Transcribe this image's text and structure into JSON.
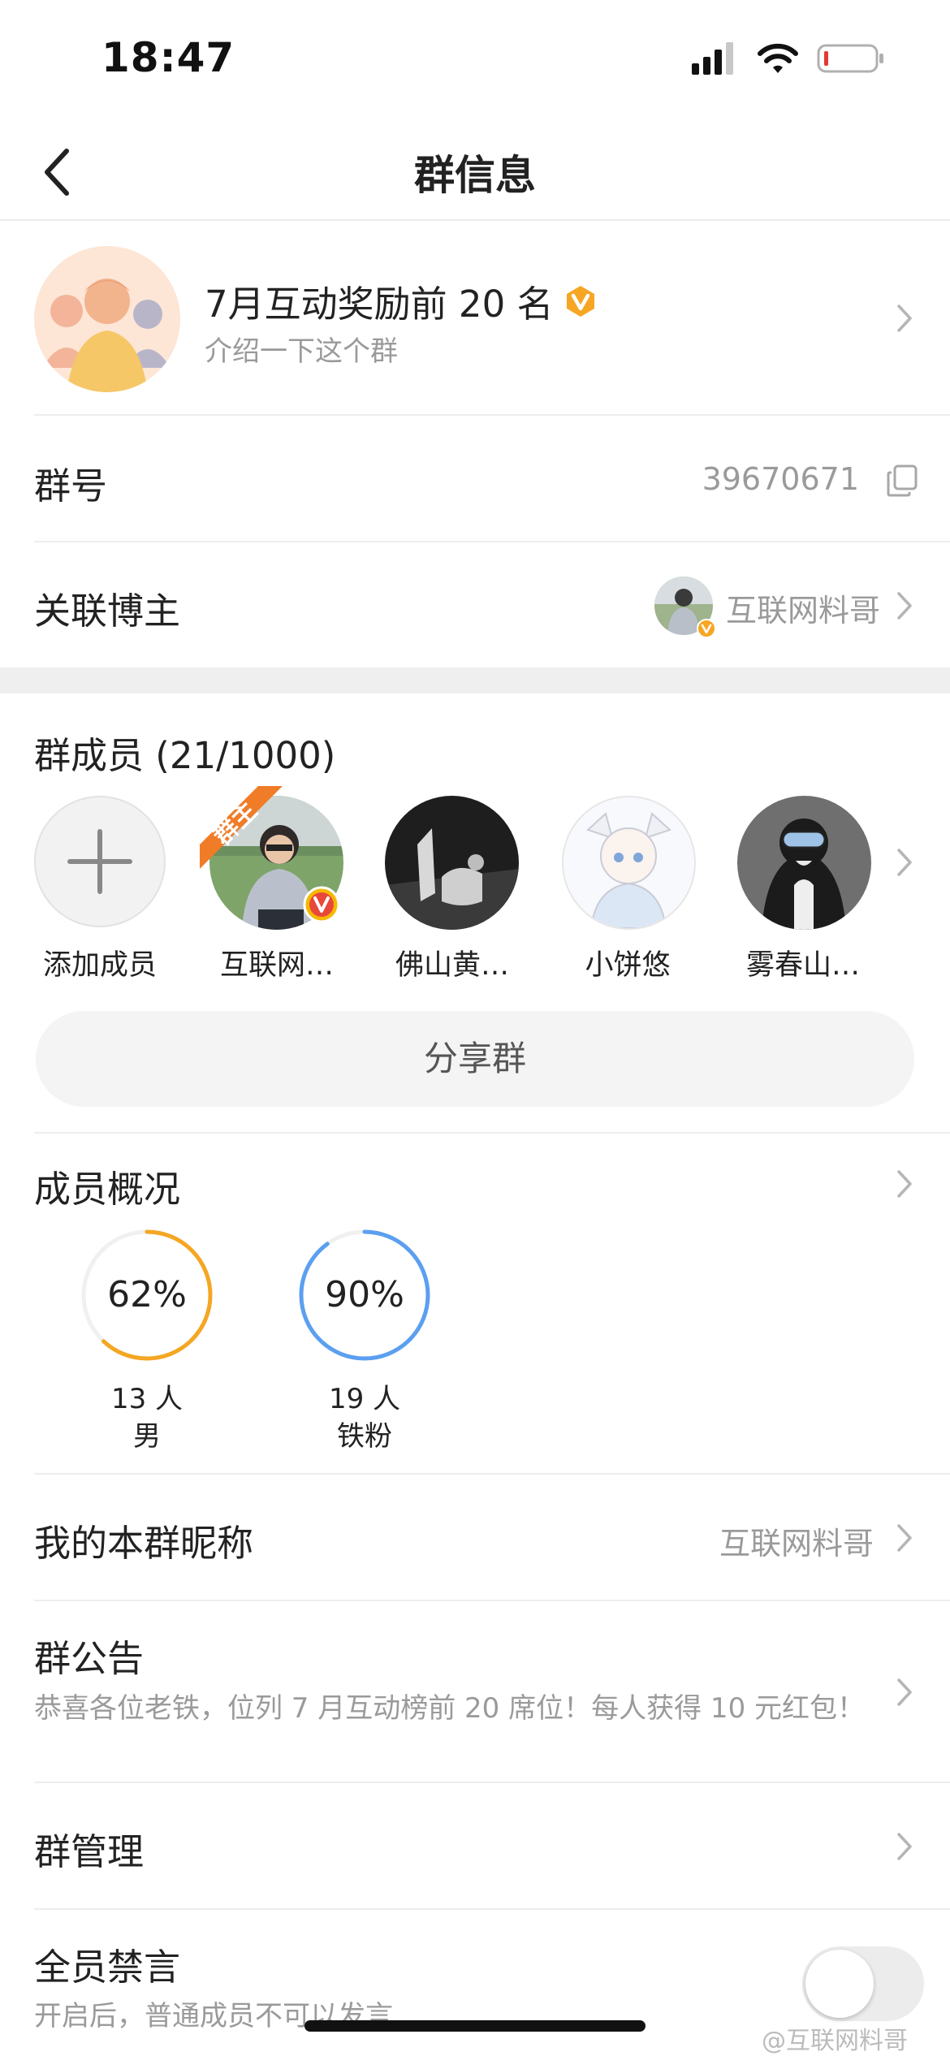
{
  "status_bar": {
    "time": "18:47"
  },
  "nav": {
    "title": "群信息"
  },
  "group": {
    "name": "7月互动奖励前 20 名",
    "description": "介绍一下这个群",
    "verified_badge": "V"
  },
  "group_id": {
    "label": "群号",
    "value": "39670671"
  },
  "linked_blogger": {
    "label": "关联博主",
    "name": "互联网料哥"
  },
  "members": {
    "title": "群成员 (21/1000)",
    "add_label": "添加成员",
    "owner_tag": "群主",
    "list": [
      {
        "name": "互联网…"
      },
      {
        "name": "佛山黄…"
      },
      {
        "name": "小饼悠"
      },
      {
        "name": "雾春山…"
      }
    ],
    "share_label": "分享群"
  },
  "overview": {
    "title": "成员概况",
    "stats": [
      {
        "percent_text": "62%",
        "percent": 62,
        "count": "13 人",
        "label": "男",
        "color": "#f5a623"
      },
      {
        "percent_text": "90%",
        "percent": 90,
        "count": "19 人",
        "label": "铁粉",
        "color": "#5b9ff0"
      }
    ]
  },
  "nickname": {
    "label": "我的本群昵称",
    "value": "互联网料哥"
  },
  "announcement": {
    "label": "群公告",
    "text": "恭喜各位老铁，位列 7 月互动榜前 20 席位！每人获得 10 元红包！"
  },
  "management": {
    "label": "群管理"
  },
  "mute_all": {
    "label": "全员禁言",
    "description": "开启后，普通成员不可以发言",
    "enabled": false
  },
  "watermark": "@互联网料哥",
  "colors": {
    "accent_orange": "#f5a623",
    "accent_blue": "#5b9ff0",
    "battery_low": "#e53935"
  }
}
